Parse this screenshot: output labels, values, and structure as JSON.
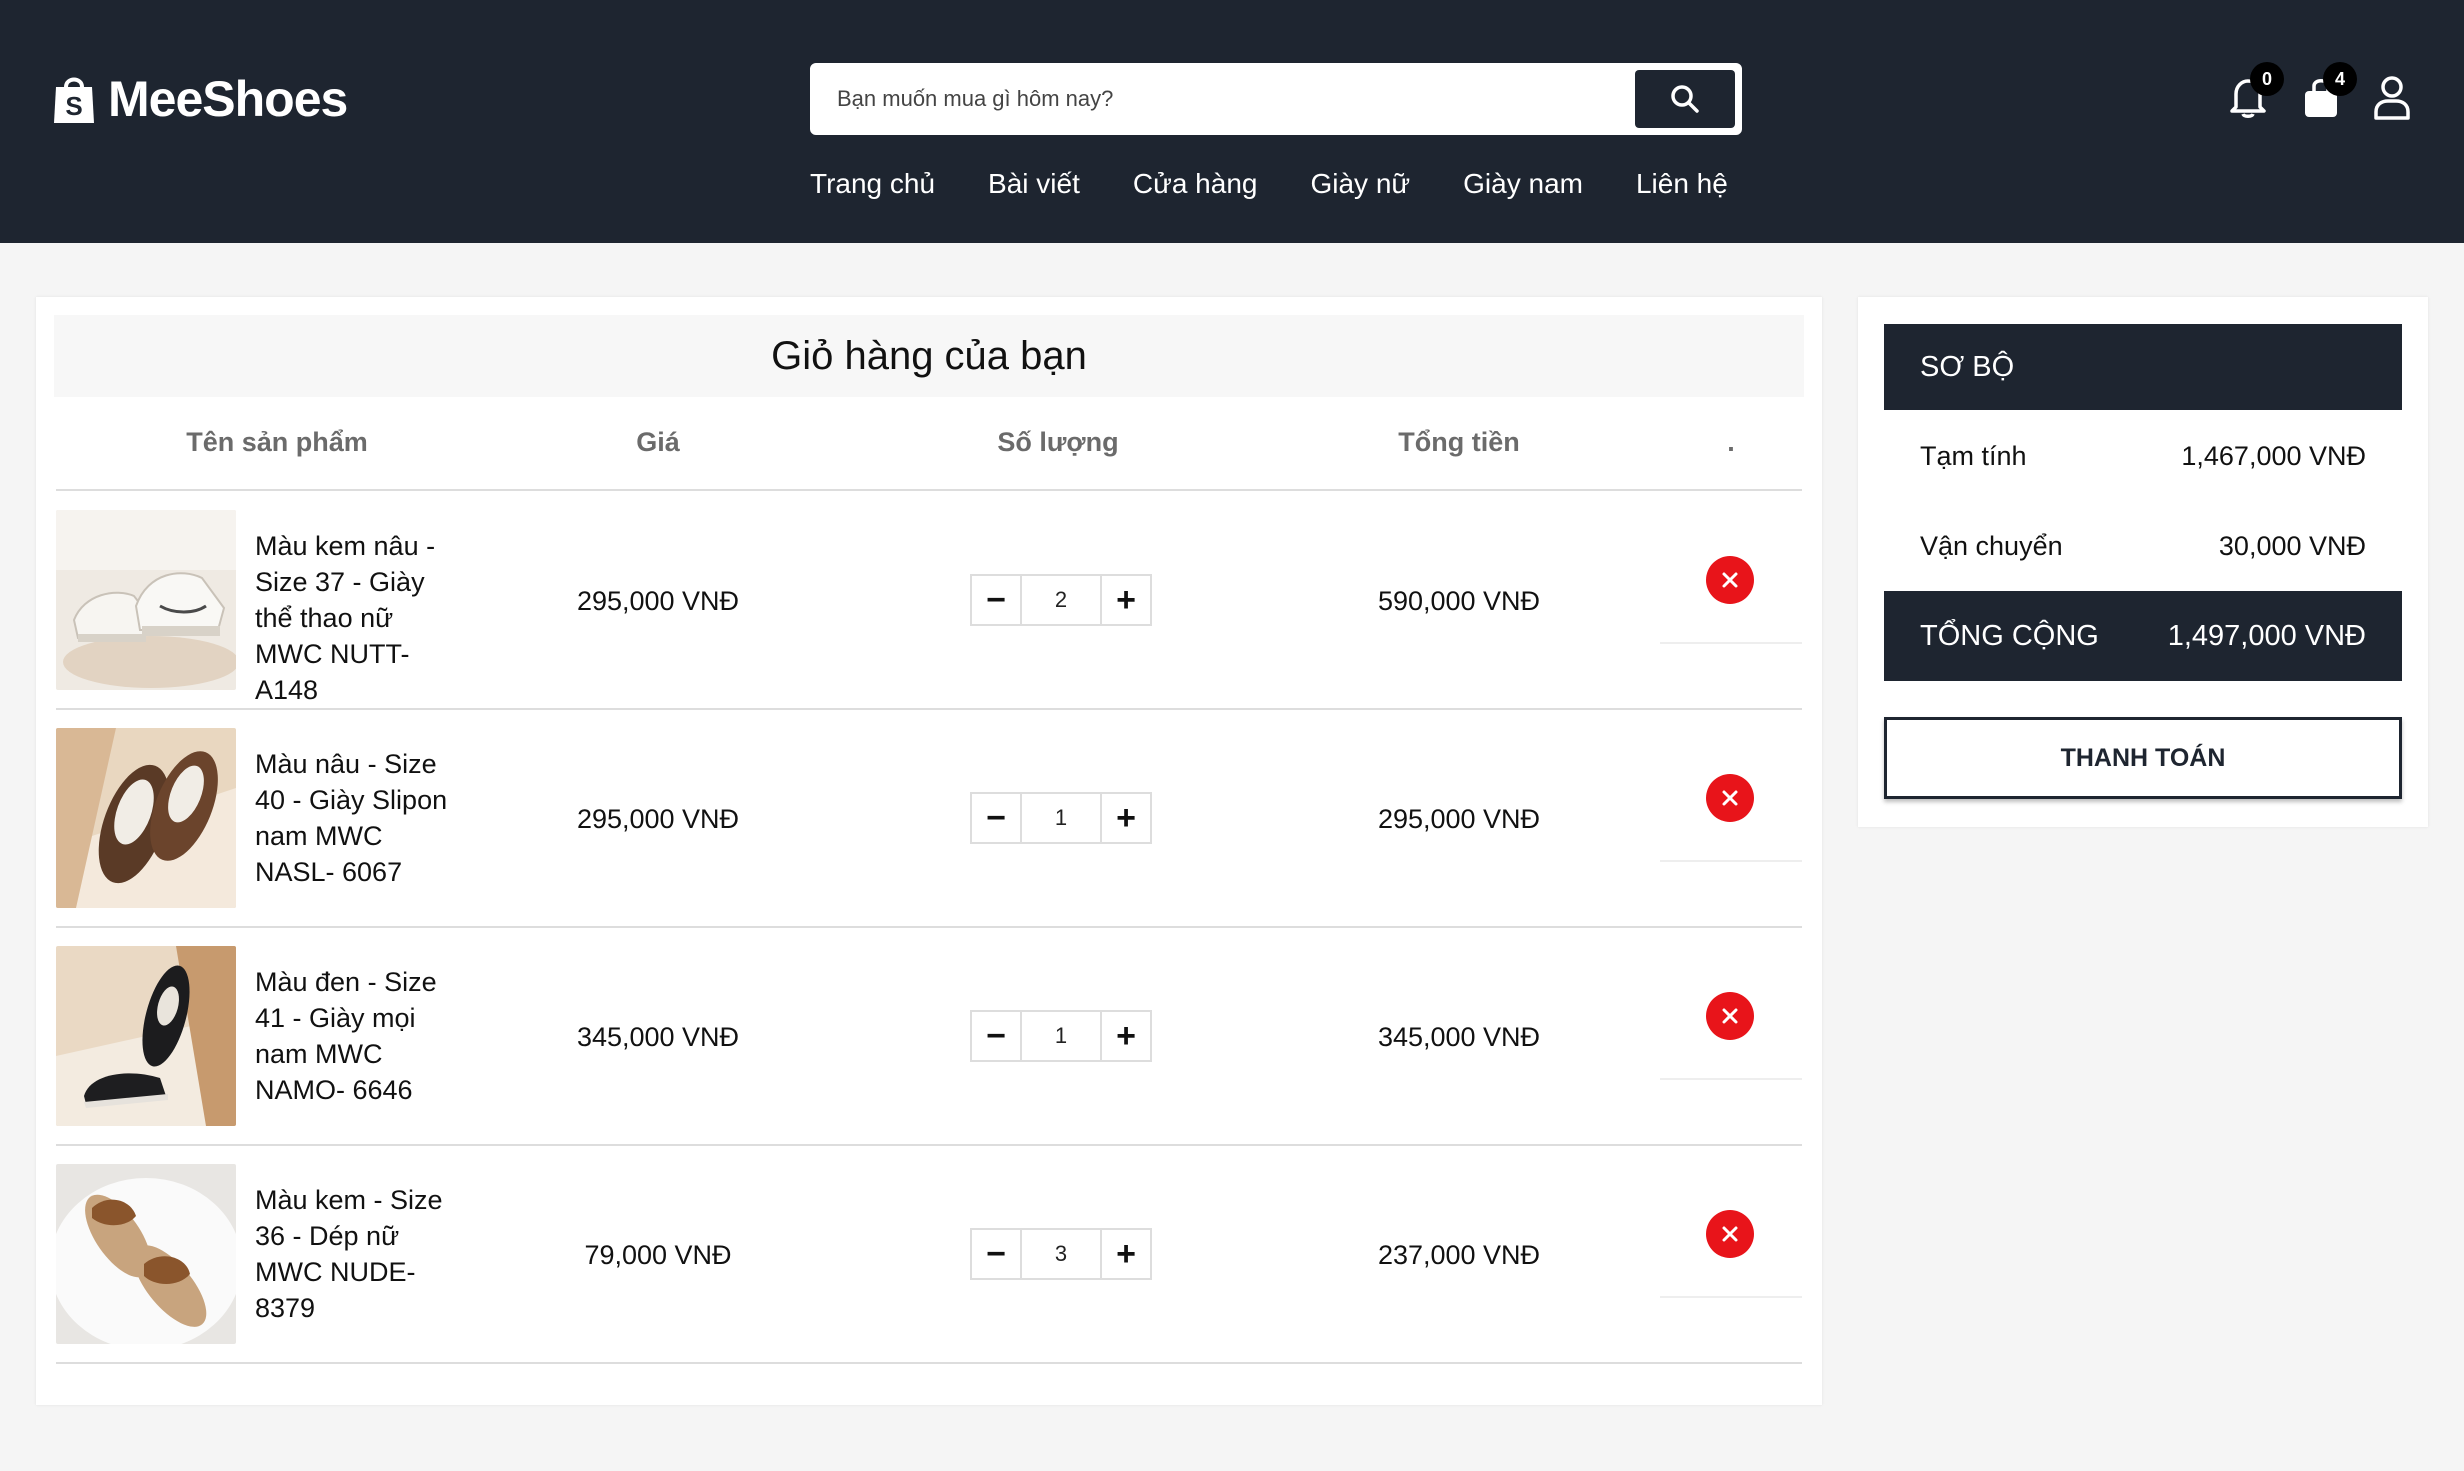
{
  "brand": {
    "name": "MeeShoes",
    "logo_icon": "shopping-bag-icon"
  },
  "search": {
    "placeholder": "Bạn muốn mua gì hôm nay?",
    "icon": "search-icon"
  },
  "nav": [
    "Trang chủ",
    "Bài viết",
    "Cửa hàng",
    "Giày nữ",
    "Giày nam",
    "Liên hệ"
  ],
  "header_icons": {
    "notifications": {
      "icon": "bell-icon",
      "count": "0"
    },
    "cart": {
      "icon": "shopping-bag-icon",
      "count": "4"
    },
    "account": {
      "icon": "user-icon"
    }
  },
  "cart": {
    "title": "Giỏ hàng của bạn",
    "headers": {
      "product": "Tên sản phẩm",
      "price": "Giá",
      "quantity": "Số lượng",
      "total": "Tổng tiền",
      "action": "."
    },
    "items": [
      {
        "name": "Màu kem nâu - Size 37 - Giày thể thao nữ MWC NUTT- A148",
        "price": "295,000 VNĐ",
        "qty": "2",
        "total": "590,000 VNĐ"
      },
      {
        "name": "Màu nâu - Size 40 - Giày Slipon nam MWC NASL- 6067",
        "price": "295,000 VNĐ",
        "qty": "1",
        "total": "295,000 VNĐ"
      },
      {
        "name": "Màu đen - Size 41 - Giày mọi nam MWC NAMO- 6646",
        "price": "345,000 VNĐ",
        "qty": "1",
        "total": "345,000 VNĐ"
      },
      {
        "name": "Màu kem - Size 36 - Dép nữ MWC NUDE- 8379",
        "price": "79,000 VNĐ",
        "qty": "3",
        "total": "237,000 VNĐ"
      }
    ]
  },
  "summary": {
    "title": "SƠ BỘ",
    "subtotal_label": "Tạm tính",
    "subtotal": "1,467,000 VNĐ",
    "shipping_label": "Vận chuyển",
    "shipping": "30,000 VNĐ",
    "total_label": "TỔNG CỘNG",
    "total": "1,497,000 VNĐ",
    "checkout": "THANH TOÁN"
  },
  "colors": {
    "header_bg": "#1e2530",
    "delete": "#e8141a",
    "page_bg": "#f5f5f5"
  }
}
